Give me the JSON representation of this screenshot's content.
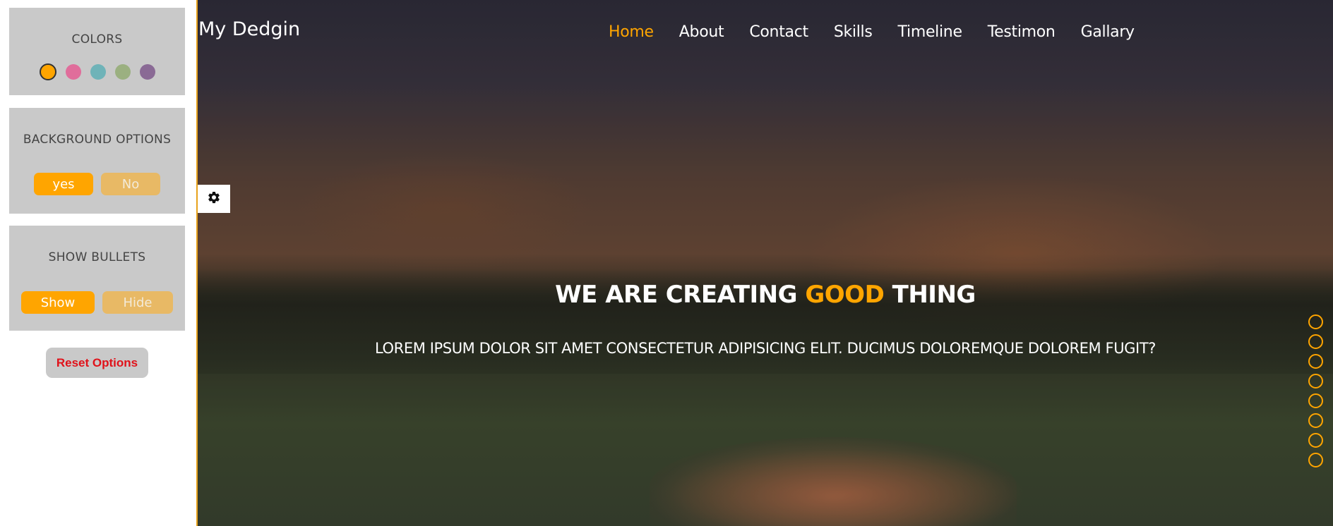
{
  "settings": {
    "colors": {
      "title": "COLORS",
      "swatches": [
        {
          "name": "orange",
          "hex": "#ffa500",
          "active": true
        },
        {
          "name": "pink",
          "hex": "#e06d9b",
          "active": false
        },
        {
          "name": "teal",
          "hex": "#6fb3b8",
          "active": false
        },
        {
          "name": "sage",
          "hex": "#9bb080",
          "active": false
        },
        {
          "name": "purple",
          "hex": "#8a6a95",
          "active": false
        }
      ]
    },
    "background": {
      "title": "BACKGROUND OPTIONS",
      "yes_label": "yes",
      "no_label": "No"
    },
    "bullets": {
      "title": "SHOW BULLETS",
      "show_label": "Show",
      "hide_label": "Hide"
    },
    "reset_label": "Reset Options"
  },
  "header": {
    "brand": "My Dedgin",
    "nav": [
      {
        "label": "Home",
        "active": true
      },
      {
        "label": "About",
        "active": false
      },
      {
        "label": "Contact",
        "active": false
      },
      {
        "label": "Skills",
        "active": false
      },
      {
        "label": "Timeline",
        "active": false
      },
      {
        "label": "Testimon",
        "active": false
      },
      {
        "label": "Gallary",
        "active": false
      }
    ]
  },
  "hero": {
    "headline_part1": "WE ARE CREATING ",
    "headline_accent": "GOOD",
    "headline_part2": " THING",
    "subline": "LOREM IPSUM DOLOR SIT AMET CONSECTETUR ADIPISICING ELIT. DUCIMUS DOLOREMQUE DOLOREM FUGIT?"
  },
  "bullets_count": 8,
  "accent_color": "#ffa500",
  "icons": {
    "settings_toggle": "gear-icon"
  }
}
